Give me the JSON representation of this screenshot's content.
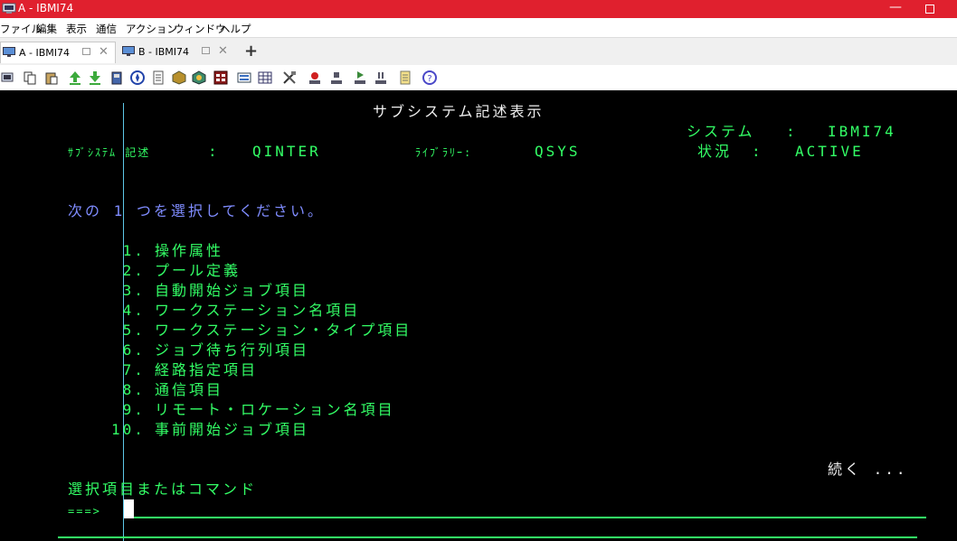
{
  "window": {
    "title": "A - IBMI74",
    "minimize": "—"
  },
  "menu": [
    "ファイル",
    "編集",
    "表示",
    "通信",
    "アクション",
    "ウィンドウ",
    "ヘルプ"
  ],
  "tabs": [
    {
      "label": "A - IBMI74",
      "active": true
    },
    {
      "label": "B - IBMI74",
      "active": false
    }
  ],
  "tab_add": "+",
  "toolbar_icons": [
    "session-icon",
    "copy-icon",
    "paste-icon",
    "send-file-icon",
    "receive-file-icon",
    "print-icon",
    "compass-icon",
    "document-icon",
    "package-icon",
    "cube-icon",
    "spreadsheet-icon",
    "keyboard-icon",
    "grid-icon",
    "settings-icon",
    "record-icon",
    "play-icon",
    "macro-icon",
    "stop-icon",
    "notepad-icon",
    "help-icon"
  ],
  "screen": {
    "title": "サブシステム記述表示",
    "system_label": "システム",
    "system_sep": ":",
    "system_value": "IBMI74",
    "subsystem_label": "ｻﾌﾞｼｽﾃﾑ 記述",
    "subsystem_sep": ":",
    "subsystem_value": "QINTER",
    "library_label": "ﾗｲﾌﾞﾗﾘｰ:",
    "library_value": "QSYS",
    "status_label": "状況",
    "status_sep": ":",
    "status_value": "ACTIVE",
    "instruction": "次の 1 つを選択してください。",
    "options": [
      {
        "num": " 1.",
        "label": "操作属性"
      },
      {
        "num": " 2.",
        "label": "プール定義"
      },
      {
        "num": " 3.",
        "label": "自動開始ジョブ項目"
      },
      {
        "num": " 4.",
        "label": "ワークステーション名項目"
      },
      {
        "num": " 5.",
        "label": "ワークステーション・タイプ項目"
      },
      {
        "num": " 6.",
        "label": "ジョブ待ち行列項目"
      },
      {
        "num": " 7.",
        "label": "経路指定項目"
      },
      {
        "num": " 8.",
        "label": "通信項目"
      },
      {
        "num": " 9.",
        "label": "リモート・ロケーション名項目"
      },
      {
        "num": "10.",
        "label": "事前開始ジョブ項目"
      }
    ],
    "more": "続く ...",
    "command_label": "選択項目またはコマンド",
    "prompt": "===>"
  }
}
